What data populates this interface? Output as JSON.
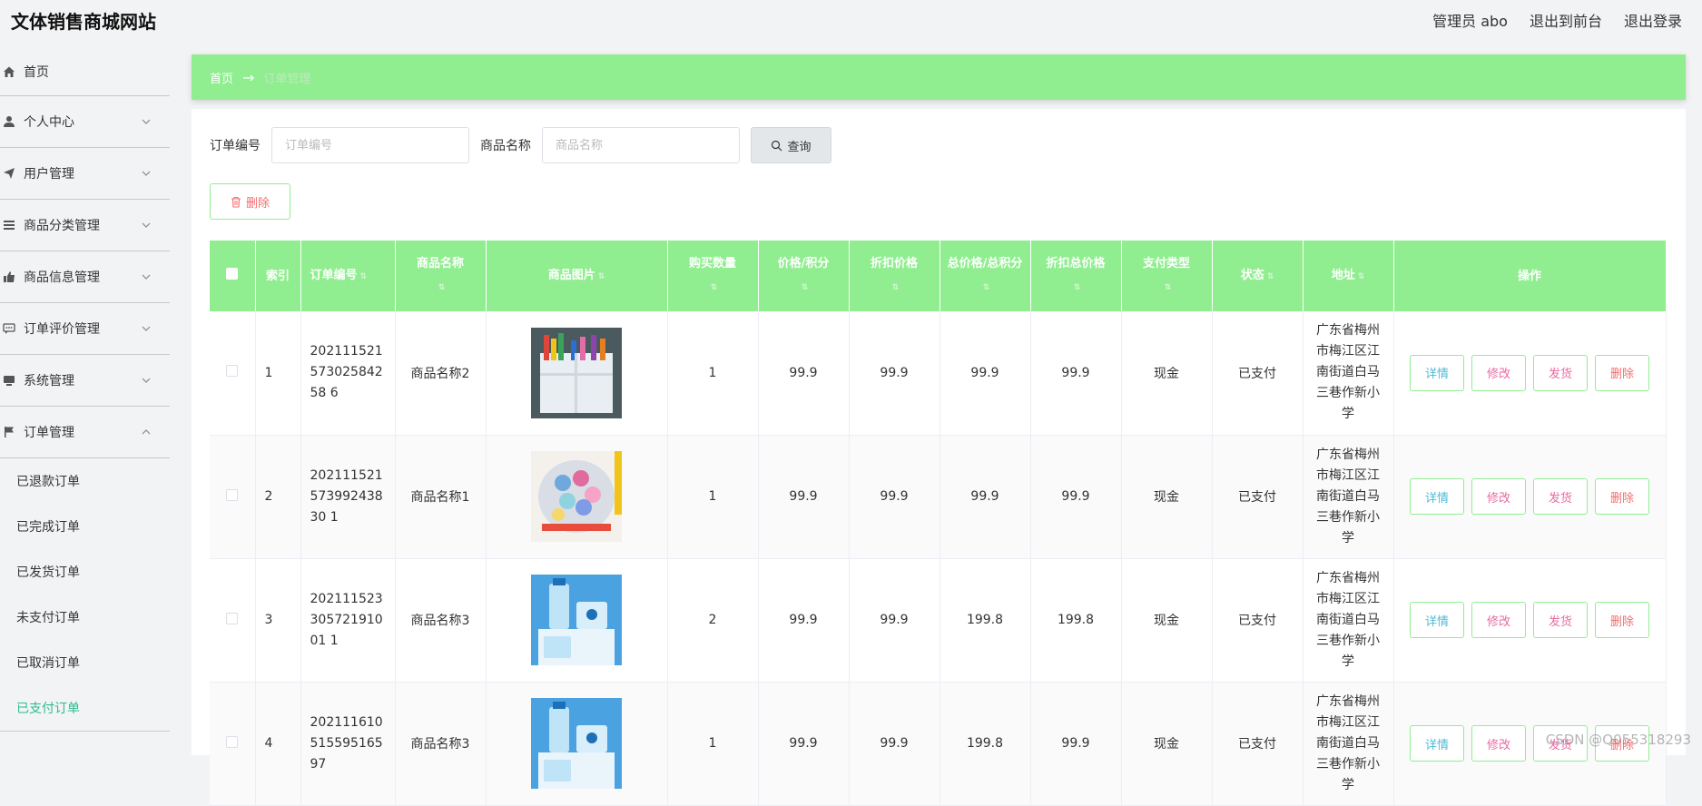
{
  "header": {
    "site_title": "文体销售商城网站",
    "admin_label": "管理员 abo",
    "front_link": "退出到前台",
    "logout_link": "退出登录"
  },
  "sidebar": {
    "items": [
      {
        "label": "首页",
        "icon": "home-icon"
      },
      {
        "label": "个人中心",
        "icon": "user-icon"
      },
      {
        "label": "用户管理",
        "icon": "send-icon"
      },
      {
        "label": "商品分类管理",
        "icon": "menu-icon"
      },
      {
        "label": "商品信息管理",
        "icon": "thumb-icon"
      },
      {
        "label": "订单评价管理",
        "icon": "chat-icon"
      },
      {
        "label": "系统管理",
        "icon": "monitor-icon"
      },
      {
        "label": "订单管理",
        "icon": "flag-icon"
      }
    ],
    "order_sub": [
      "已退款订单",
      "已完成订单",
      "已发货订单",
      "未支付订单",
      "已取消订单",
      "已支付订单"
    ],
    "active_sub": "已支付订单"
  },
  "breadcrumb": {
    "home": "首页",
    "arrow": "→",
    "current": "订单管理"
  },
  "search": {
    "order_no_label": "订单编号",
    "order_no_placeholder": "订单编号",
    "product_label": "商品名称",
    "product_placeholder": "商品名称",
    "query_button": "查询",
    "delete_button": "删除"
  },
  "table": {
    "headers": [
      "索引",
      "订单编号",
      "商品名称",
      "商品图片",
      "购买数量",
      "价格/积分",
      "折扣价格",
      "总价格/总积分",
      "折扣总价格",
      "支付类型",
      "状态",
      "地址",
      "操作"
    ],
    "actions": {
      "detail": "详情",
      "edit": "修改",
      "ship": "发货",
      "delete": "删除"
    },
    "rows": [
      {
        "index": "1",
        "order_no": "20211152157302584258 6",
        "product": "商品名称2",
        "image": "pen-holder",
        "qty": "1",
        "price": "99.9",
        "discount_price": "99.9",
        "total": "99.9",
        "discount_total": "99.9",
        "pay_type": "现金",
        "status": "已支付",
        "address": "广东省梅州市梅江区江南街道白马三巷作新小学"
      },
      {
        "index": "2",
        "order_no": "20211152157399243830 1",
        "product": "商品名称1",
        "image": "clips-jar",
        "qty": "1",
        "price": "99.9",
        "discount_price": "99.9",
        "total": "99.9",
        "discount_total": "99.9",
        "pay_type": "现金",
        "status": "已支付",
        "address": "广东省梅州市梅江区江南街道白马三巷作新小学"
      },
      {
        "index": "3",
        "order_no": "20211152330572191001 1",
        "product": "商品名称3",
        "image": "blue-bottles",
        "qty": "2",
        "price": "99.9",
        "discount_price": "99.9",
        "total": "199.8",
        "discount_total": "199.8",
        "pay_type": "现金",
        "status": "已支付",
        "address": "广东省梅州市梅江区江南街道白马三巷作新小学"
      },
      {
        "index": "4",
        "order_no": "20211161051559516597",
        "product": "商品名称3",
        "image": "blue-bottles",
        "qty": "1",
        "price": "99.9",
        "discount_price": "99.9",
        "total": "199.8",
        "discount_total": "99.9",
        "pay_type": "现金",
        "status": "已支付",
        "address": "广东省梅州市梅江区江南街道白马三巷作新小学"
      }
    ]
  },
  "watermark": "CSDN @Q055318293",
  "colors": {
    "accent": "#90ee90",
    "active_menu": "#2bbd8f",
    "danger": "#f56c6c",
    "info": "#4dbbd6",
    "edit": "#e86ba2"
  }
}
